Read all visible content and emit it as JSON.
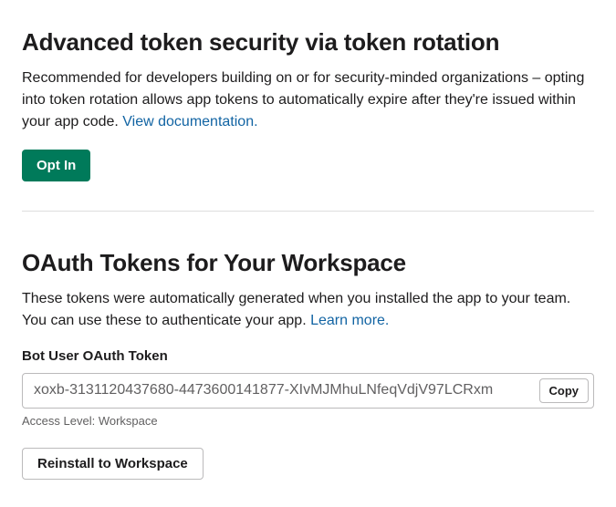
{
  "token_rotation": {
    "heading": "Advanced token security via token rotation",
    "description_prefix": "Recommended for developers building on or for security-minded organizations – opting into token rotation allows app tokens to automatically expire after they're issued within your app code. ",
    "doc_link_text": "View documentation.",
    "opt_in_label": "Opt In"
  },
  "oauth_tokens": {
    "heading": "OAuth Tokens for Your Workspace",
    "description_prefix": "These tokens were automatically generated when you installed the app to your team. You can use these to authenticate your app. ",
    "learn_more_text": "Learn more.",
    "bot_token_label": "Bot User OAuth Token",
    "bot_token_value": "xoxb-3131120437680-4473600141877-XIvMJMhuLNfeqVdjV97LCRxm",
    "copy_label": "Copy",
    "access_level": "Access Level: Workspace",
    "reinstall_label": "Reinstall to Workspace"
  }
}
